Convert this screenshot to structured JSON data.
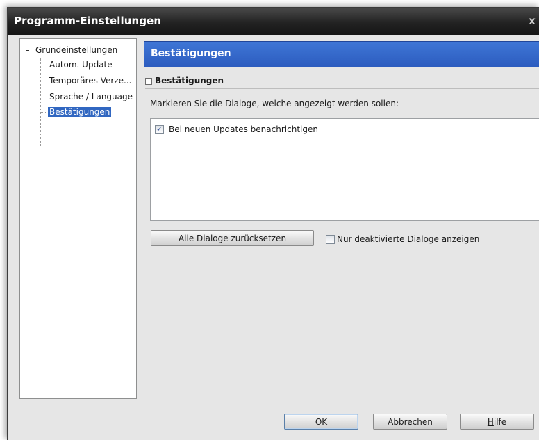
{
  "window": {
    "title": "Programm-Einstellungen",
    "close_symbol": "x"
  },
  "tree": {
    "root_label": "Grundeinstellungen",
    "items": [
      {
        "label": "Autom. Update",
        "selected": false
      },
      {
        "label": "Temporäres Verze...",
        "selected": false
      },
      {
        "label": "Sprache / Language",
        "selected": false
      },
      {
        "label": "Bestätigungen",
        "selected": true
      }
    ]
  },
  "content": {
    "header_title": "Bestätigungen",
    "section_title": "Bestätigungen",
    "instruction": "Markieren Sie die Dialoge, welche angezeigt werden sollen:",
    "dialogs": [
      {
        "label": "Bei neuen Updates benachrichtigen",
        "checked": true
      }
    ],
    "reset_button": "Alle Dialoge zurücksetzen",
    "only_disabled_label": "Nur deaktivierte Dialoge anzeigen",
    "only_disabled_checked": false
  },
  "footer": {
    "ok": "OK",
    "cancel": "Abbrechen",
    "help_prefix": "H",
    "help_rest": "ilfe"
  },
  "colors": {
    "accent": "#3167c1",
    "banner": "#3a6dd0",
    "titlebar": "#222222"
  }
}
